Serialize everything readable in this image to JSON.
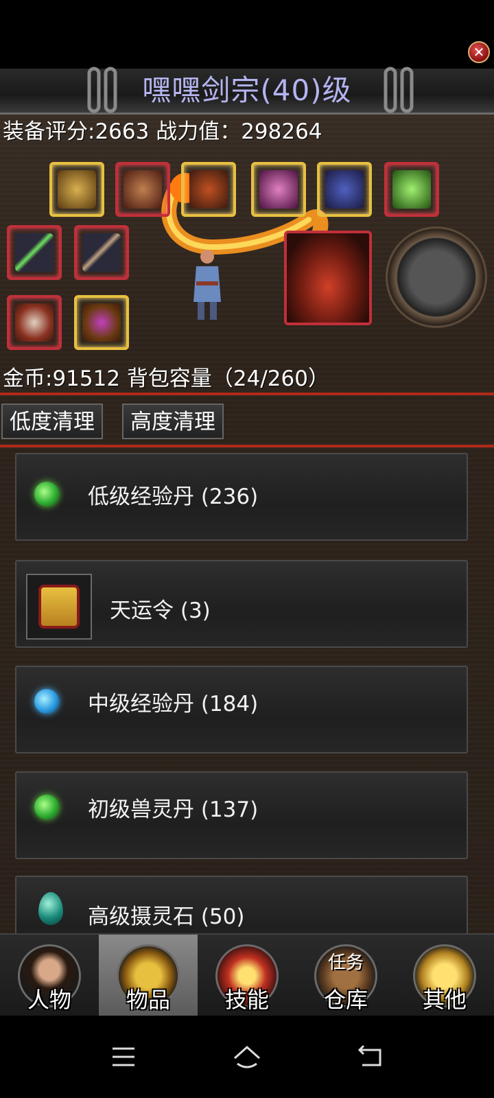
{
  "window": {
    "title": "嘿嘿剑宗(40)级",
    "close_icon": "close-icon"
  },
  "stats": {
    "equip_score": "装备评分:2663 战力值：298264",
    "gold_capacity": "金币:91512 背包容量（24/260）"
  },
  "actions": {
    "low_clean": "低度清理",
    "high_clean": "高度清理"
  },
  "items": [
    {
      "label": "低级经验丹 (236)",
      "icon": "green-orb-icon"
    },
    {
      "label": "天运令 (3)",
      "icon": "token-icon"
    },
    {
      "label": "中级经验丹 (184)",
      "icon": "blue-orb-icon"
    },
    {
      "label": "初级兽灵丹 (137)",
      "icon": "green-orb-icon"
    },
    {
      "label": "高级摄灵石 (50)",
      "icon": "teal-stone-icon"
    }
  ],
  "tabs": [
    {
      "label": "人物",
      "icon": "character-portrait-icon",
      "active": false
    },
    {
      "label": "物品",
      "icon": "golden-armor-icon",
      "active": true
    },
    {
      "label": "技能",
      "icon": "sword-skill-icon",
      "active": false
    },
    {
      "label": "仓库",
      "icon": "treasure-chest-icon",
      "badge": "任务",
      "active": false
    },
    {
      "label": "其他",
      "icon": "golden-trophy-icon",
      "active": false
    }
  ],
  "colors": {
    "title": "#b4b4f0",
    "divider": "#b02a1a",
    "slot_red": "#c0303a",
    "slot_gold": "#e8c040"
  }
}
